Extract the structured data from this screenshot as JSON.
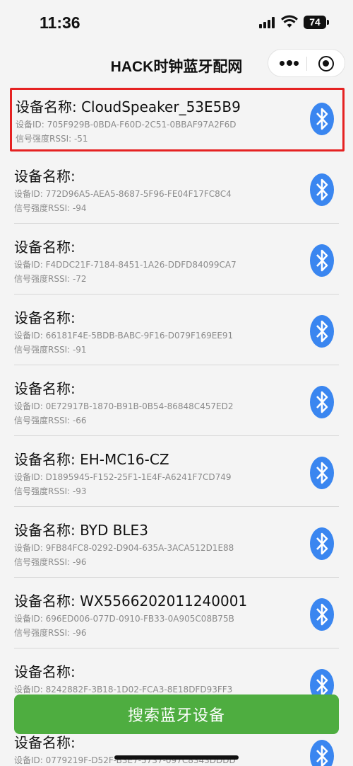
{
  "status_bar": {
    "time": "11:36",
    "battery": "74"
  },
  "nav": {
    "title": "HACK时钟蓝牙配网"
  },
  "colors": {
    "bluetooth": "#3a86f0",
    "button": "#4ead40",
    "highlight": "#e52222"
  },
  "devices": [
    {
      "name": "设备名称: CloudSpeaker_53E5B9",
      "id": "设备ID: 705F929B-0BDA-F60D-2C51-0BBAF97A2F6D",
      "rssi": "信号强度RSSI: -51"
    },
    {
      "name": "设备名称:",
      "id": "设备ID: 772D96A5-AEA5-8687-5F96-FE04F17FC8C4",
      "rssi": "信号强度RSSI: -94"
    },
    {
      "name": "设备名称:",
      "id": "设备ID: F4DDC21F-7184-8451-1A26-DDFD84099CA7",
      "rssi": "信号强度RSSI: -72"
    },
    {
      "name": "设备名称:",
      "id": "设备ID: 66181F4E-5BDB-BABC-9F16-D079F169EE91",
      "rssi": "信号强度RSSI: -91"
    },
    {
      "name": "设备名称:",
      "id": "设备ID: 0E72917B-1870-B91B-0B54-86848C457ED2",
      "rssi": "信号强度RSSI: -66"
    },
    {
      "name": "设备名称: EH-MC16-CZ",
      "id": "设备ID: D1895945-F152-25F1-1E4F-A6241F7CD749",
      "rssi": "信号强度RSSI: -93"
    },
    {
      "name": "设备名称: BYD BLE3",
      "id": "设备ID: 9FB84FC8-0292-D904-635A-3ACA512D1E88",
      "rssi": "信号强度RSSI: -96"
    },
    {
      "name": "设备名称: WX5566202011240001",
      "id": "设备ID: 696ED006-077D-0910-FB33-0A905C08B75B",
      "rssi": "信号强度RSSI: -96"
    },
    {
      "name": "设备名称:",
      "id": "设备ID: 8242882F-3B18-1D02-FCA3-8E18DFD93FF3",
      "rssi": ""
    },
    {
      "name": "设备名称:",
      "id": "设备ID: 0779219F-D52F-B3E7-5737-097C8343DDDD",
      "rssi": ""
    }
  ],
  "search_button": {
    "label": "搜索蓝牙设备"
  }
}
